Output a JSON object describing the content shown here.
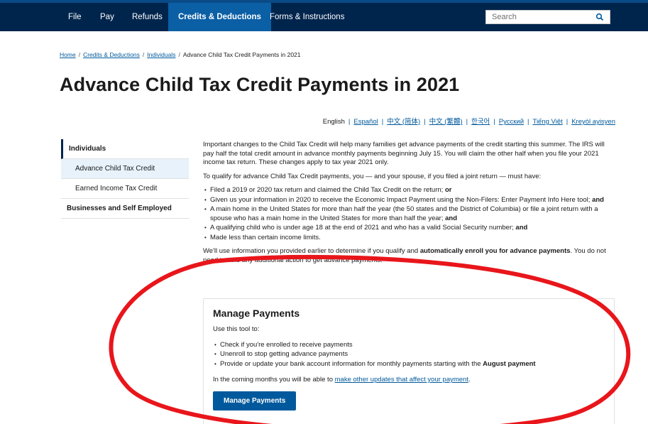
{
  "nav": {
    "items": [
      {
        "label": "File"
      },
      {
        "label": "Pay"
      },
      {
        "label": "Refunds"
      },
      {
        "label": "Credits & Deductions"
      },
      {
        "label": "Forms & Instructions"
      }
    ],
    "active_index": 3,
    "search_placeholder": "Search",
    "search_icon": "search-icon"
  },
  "breadcrumb": {
    "items": [
      "Home",
      "Credits & Deductions",
      "Individuals"
    ],
    "separator": "/",
    "current": "Advance Child Tax Credit Payments in 2021"
  },
  "page_title": "Advance Child Tax Credit Payments in 2021",
  "languages": {
    "current": "English",
    "others": [
      "Español",
      "中文 (简体)",
      "中文 (繁體)",
      "한국어",
      "Русский",
      "Tiếng Việt",
      "Kreyòl ayisyen"
    ]
  },
  "sidebar": {
    "heading": "Individuals",
    "subitems": [
      "Advance Child Tax Credit",
      "Earned Income Tax Credit"
    ],
    "active_subitem": 0,
    "other": "Businesses and Self Employed"
  },
  "main": {
    "intro": "Important changes to the Child Tax Credit will help many families get advance payments of the credit starting this summer. The IRS will pay half the total credit amount in advance monthly payments beginning July 15. You will claim the other half when you file your 2021 income tax return. These changes apply to tax year 2021 only.",
    "qualify": "To qualify for advance Child Tax Credit payments, you — and your spouse, if you filed a joint return — must have:",
    "reqs": [
      {
        "text": "Filed a 2019 or 2020 tax return and claimed the Child Tax Credit on the return; ",
        "bold": "or"
      },
      {
        "text": "Given us your information in 2020 to receive the Economic Impact Payment using the Non-Filers: Enter Payment Info Here tool; ",
        "bold": "and"
      },
      {
        "text": "A main home in the United States for more than half the year (the 50 states and the District of Columbia) or file a joint return with a spouse who has a main home in the United States for more than half the year; ",
        "bold": "and"
      },
      {
        "text": "A qualifying child who is under age 18 at the end of 2021 and who has a valid Social Security number; ",
        "bold": "and"
      },
      {
        "text": "Made less than certain income limits.",
        "bold": ""
      }
    ],
    "auto_pre": "We'll use information you provided earlier to determine if you qualify and ",
    "auto_bold": "automatically enroll you for advance payments",
    "auto_post": ". You do not need to take any additional action to get advance payments."
  },
  "panel": {
    "title": "Manage Payments",
    "lead": "Use this tool to:",
    "bullets": [
      {
        "text": "Check if you're enrolled to receive payments",
        "bold": ""
      },
      {
        "text": "Unenroll to stop getting advance payments",
        "bold": ""
      },
      {
        "text": "Provide or update your bank account information for monthly payments starting with the ",
        "bold": "August payment"
      }
    ],
    "coming_pre": "In the coming months you will be able to ",
    "coming_link": "make other updates that affect your payment",
    "coming_post": ".",
    "button": "Manage Payments"
  },
  "colors": {
    "nav_bg": "#00254d",
    "nav_active": "#0b5fa5",
    "link": "#00599c",
    "button": "#00599c",
    "annotation": "#e8161b"
  }
}
